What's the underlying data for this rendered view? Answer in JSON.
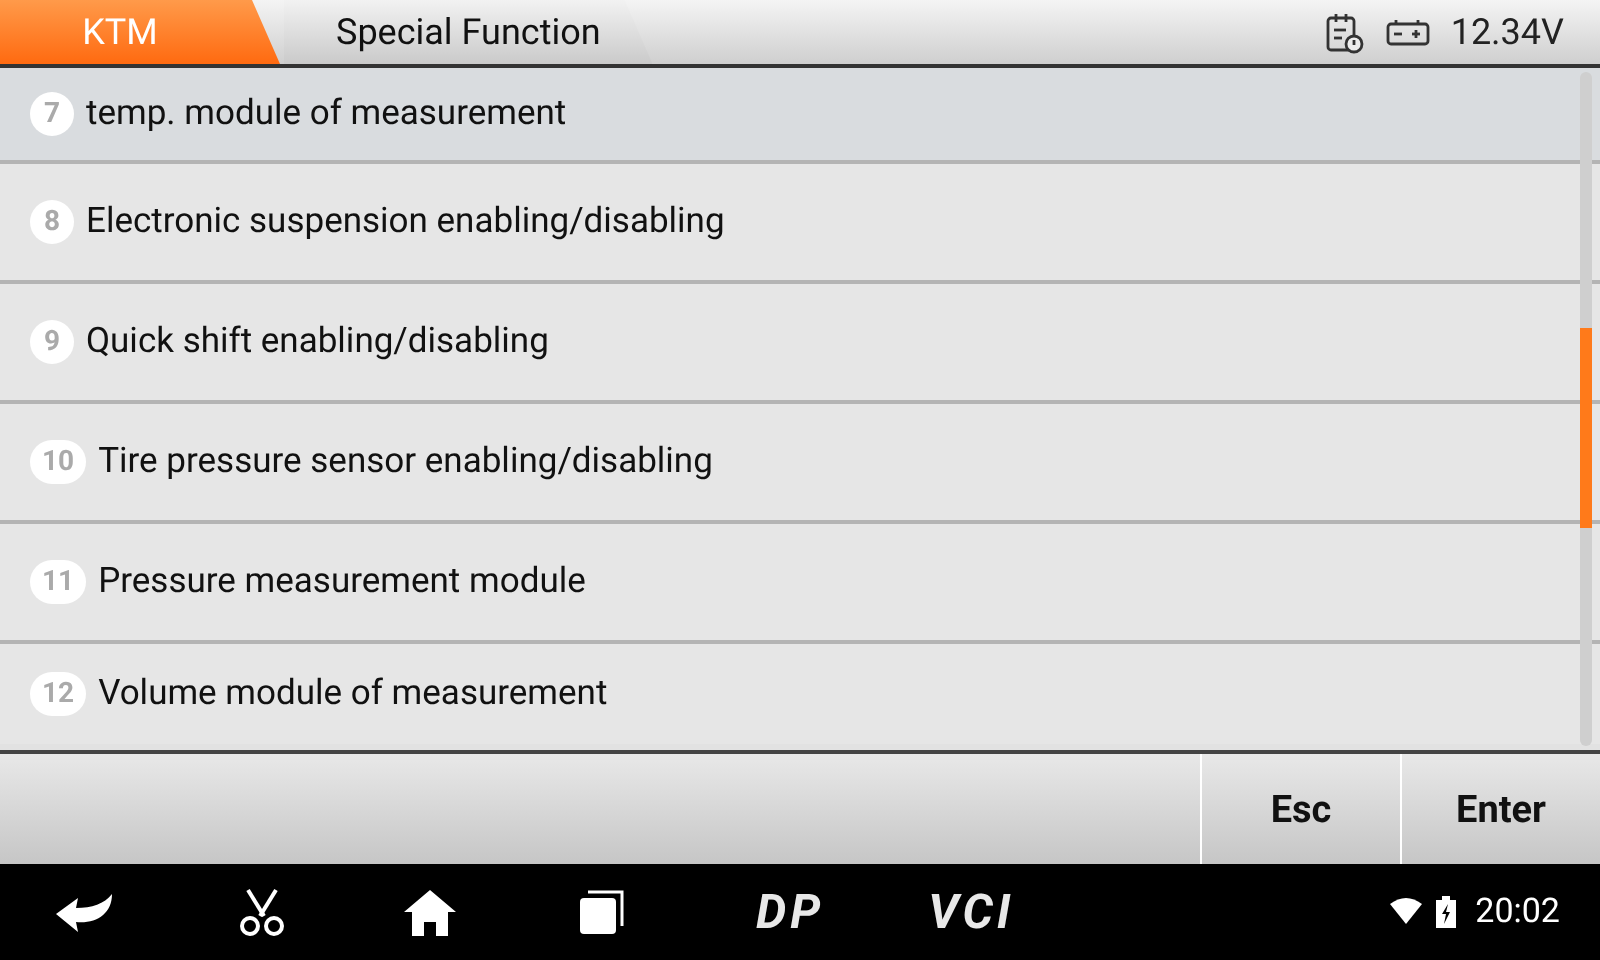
{
  "header": {
    "tabs": [
      {
        "label": "KTM",
        "selected": true
      },
      {
        "label": "Special Function",
        "selected": false
      }
    ],
    "voltage": "12.34V"
  },
  "items": [
    {
      "number": "7",
      "label": "temp. module of measurement",
      "selected": true
    },
    {
      "number": "8",
      "label": "Electronic suspension enabling/disabling",
      "selected": false
    },
    {
      "number": "9",
      "label": "Quick shift enabling/disabling",
      "selected": false
    },
    {
      "number": "10",
      "label": "Tire pressure sensor enabling/disabling",
      "selected": false
    },
    {
      "number": "11",
      "label": "Pressure measurement module",
      "selected": false
    },
    {
      "number": "12",
      "label": "Volume module of measurement",
      "selected": false
    }
  ],
  "buttons": [
    "Esc",
    "Enter"
  ],
  "nav_bar": {
    "logos": [
      "DP",
      "VCI"
    ],
    "time": "20:02"
  }
}
